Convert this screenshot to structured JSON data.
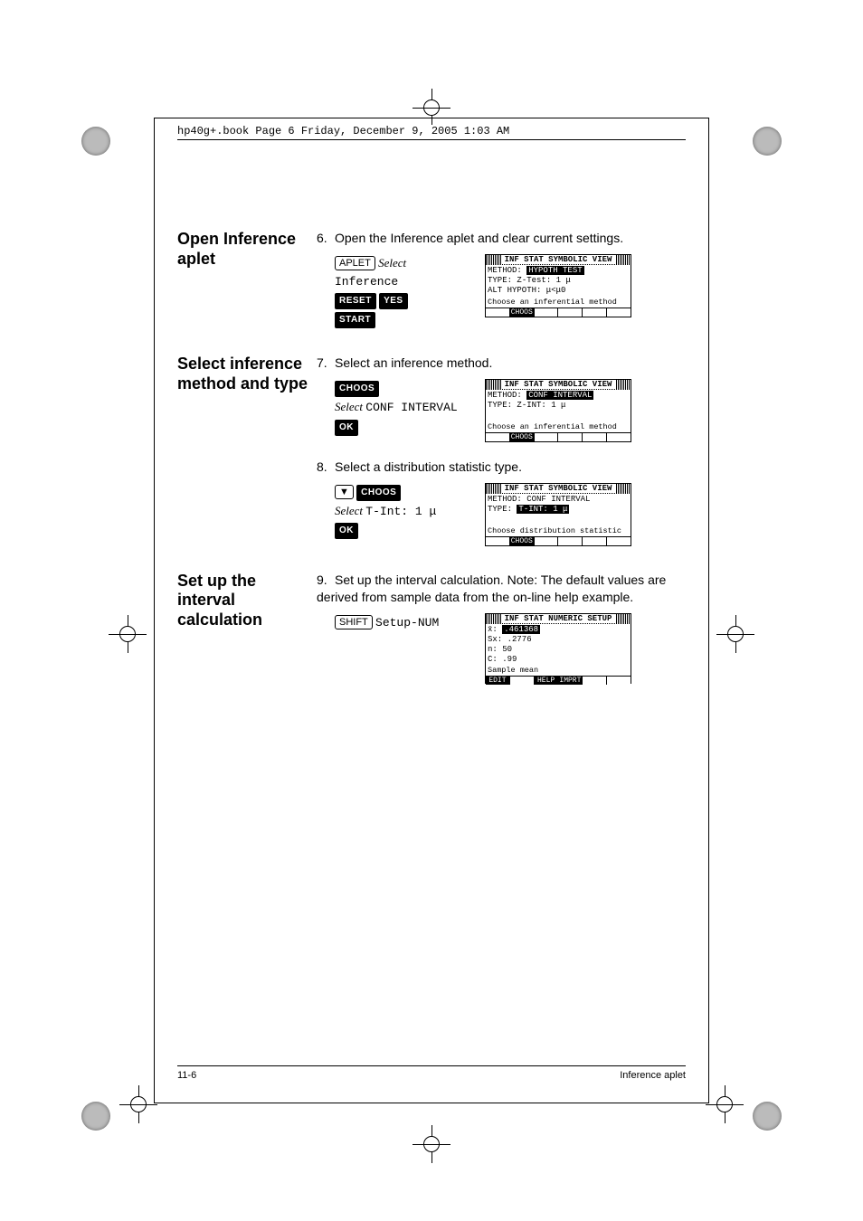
{
  "header_line": "hp40g+.book  Page 6  Friday, December 9, 2005  1:03 AM",
  "sections": {
    "open": {
      "heading": "Open Inference aplet",
      "step_num": "6.",
      "step_text": "Open the Inference aplet and clear current settings.",
      "keys": {
        "aplet": "APLET",
        "select": "Select",
        "inference": "Inference",
        "reset": "RESET",
        "yes": "YES",
        "start": "START"
      },
      "screen": {
        "title": "INF STAT SYMBOLIC VIEW",
        "l1_label": "METHOD:",
        "l1_val": "HYPOTH TEST",
        "l2_label": "TYPE:",
        "l2_val": "Z-Test: 1 μ",
        "l3": "ALT HYPOTH: μ<μ0",
        "msg": "Choose an inferential method",
        "menu": [
          "",
          "CHOOS",
          "",
          "",
          "",
          ""
        ]
      }
    },
    "select": {
      "heading": "Select inference method and type",
      "step7_num": "7.",
      "step7_text": "Select an inference method.",
      "keys7": {
        "choos": "CHOOS",
        "select": "Select",
        "conf": "CONF INTERVAL",
        "ok": "OK"
      },
      "screen7": {
        "title": "INF STAT SYMBOLIC VIEW",
        "l1_label": "METHOD:",
        "l1_val": "CONF INTERVAL",
        "l2_label": "TYPE:",
        "l2_val": "Z-INT: 1 μ",
        "msg": "Choose an inferential method",
        "menu": [
          "",
          "CHOOS",
          "",
          "",
          "",
          ""
        ]
      },
      "step8_num": "8.",
      "step8_text": "Select a distribution statistic type.",
      "keys8": {
        "down": "▼",
        "choos": "CHOOS",
        "select": "Select",
        "tint": "T-Int: 1 μ",
        "ok": "OK"
      },
      "screen8": {
        "title": "INF STAT SYMBOLIC VIEW",
        "l1_label": "METHOD:",
        "l1_val": "CONF INTERVAL",
        "l2_label": "TYPE:",
        "l2_val": "T-INT: 1 μ",
        "msg": "Choose distribution statistic",
        "menu": [
          "",
          "CHOOS",
          "",
          "",
          "",
          ""
        ]
      }
    },
    "setup": {
      "heading": "Set up the interval calculation",
      "step_num": "9.",
      "step_text": "Set up the interval calculation. Note: The default values are derived from sample data from the on-line help example.",
      "keys": {
        "shift": "SHIFT",
        "setup": "Setup-NUM"
      },
      "screen": {
        "title": "INF STAT NUMERIC SETUP",
        "l1_label": "x̄:",
        "l1_val": ".461368",
        "l2": "Sx: .2776",
        "l3": "n:  50",
        "l4": "C:  .99",
        "msg": "Sample mean",
        "menu": [
          "EDIT",
          "",
          "HELP",
          "IMPRT",
          "",
          ""
        ]
      }
    }
  },
  "footer": {
    "page": "11-6",
    "title": "Inference aplet"
  }
}
